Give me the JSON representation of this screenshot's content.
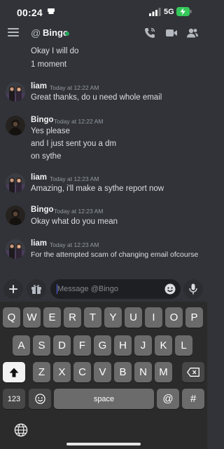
{
  "status_bar": {
    "time": "00:24",
    "network": "5G"
  },
  "header": {
    "at_symbol": "@",
    "channel_name": "Bingo"
  },
  "messages": [
    {
      "type": "continuation",
      "lines": [
        "Okay I will do",
        "1 moment"
      ]
    },
    {
      "type": "message",
      "author": "liam",
      "timestamp": "Today at 12:22 AM",
      "lines": [
        "Great thanks, do u need whole email"
      ]
    },
    {
      "type": "message",
      "author": "Bingo",
      "timestamp": "Today at 12:22 AM",
      "lines": [
        "Yes please",
        "and I just sent you a dm",
        "on sythe"
      ]
    },
    {
      "type": "message",
      "author": "liam",
      "timestamp": "Today at 12:23 AM",
      "lines": [
        "Amazing, i'll make a sythe report now"
      ]
    },
    {
      "type": "message",
      "author": "Bingo",
      "timestamp": "Today at 12:23 AM",
      "lines": [
        "Okay what do you mean"
      ]
    },
    {
      "type": "message",
      "author": "liam",
      "timestamp": "Today at 12:23 AM",
      "lines": [
        "For the attempted scam of changing email ofcourse"
      ]
    }
  ],
  "composer": {
    "placeholder": "Message @Bingo"
  },
  "keyboard": {
    "row1": [
      "Q",
      "W",
      "E",
      "R",
      "T",
      "Y",
      "U",
      "I",
      "O",
      "P"
    ],
    "row2": [
      "A",
      "S",
      "D",
      "F",
      "G",
      "H",
      "J",
      "K",
      "L"
    ],
    "row3": [
      "Z",
      "X",
      "C",
      "V",
      "B",
      "N",
      "M"
    ],
    "numbers_key": "123",
    "space_key": "space",
    "at_key": "@",
    "hash_key": "#"
  },
  "colors": {
    "background": "#313338",
    "online": "#23a55a",
    "accent": "#5865f2"
  }
}
